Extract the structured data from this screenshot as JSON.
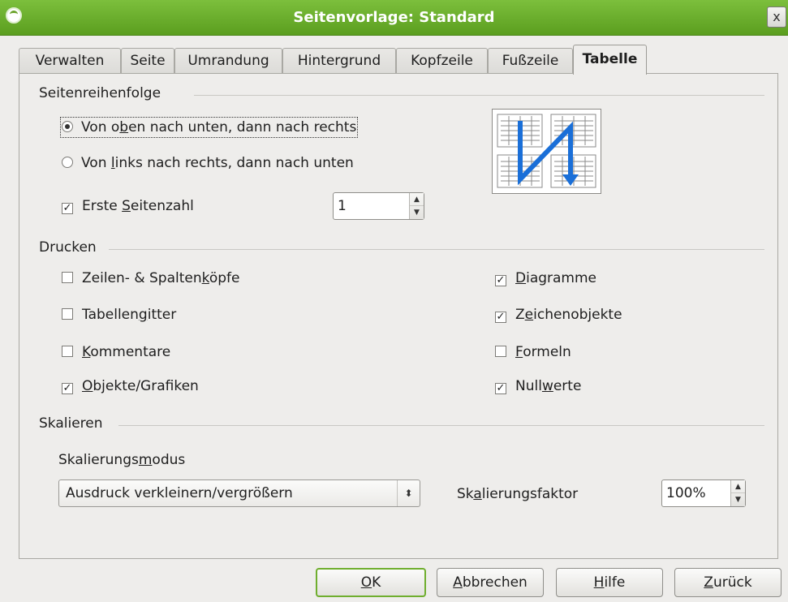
{
  "window": {
    "title": "Seitenvorlage: Standard",
    "close_glyph": "x"
  },
  "tabs": [
    {
      "label": "Verwalten",
      "active": false
    },
    {
      "label": "Seite",
      "active": false
    },
    {
      "label": "Umrandung",
      "active": false
    },
    {
      "label": "Hintergrund",
      "active": false
    },
    {
      "label": "Kopfzeile",
      "active": false
    },
    {
      "label": "Fußzeile",
      "active": false
    },
    {
      "label": "Tabelle",
      "active": true
    }
  ],
  "page_order": {
    "title": "Seitenreihenfolge",
    "options": [
      {
        "pre": "Von o",
        "key": "b",
        "post": "en nach unten, dann nach rechts",
        "selected": true
      },
      {
        "pre": "Von ",
        "key": "l",
        "post": "inks nach rechts, dann nach unten",
        "selected": false
      }
    ],
    "first_page": {
      "pre": "Erste ",
      "key": "S",
      "post": "eitenzahl",
      "checked": true,
      "value": "1"
    }
  },
  "print": {
    "title": "Drucken",
    "left": [
      {
        "pre": "Zeilen- & Spalten",
        "key": "k",
        "post": "öpfe",
        "checked": false
      },
      {
        "pre": "Tabellen",
        "key": "g",
        "post": "itter",
        "checked": false
      },
      {
        "pre": "",
        "key": "K",
        "post": "ommentare",
        "checked": false
      },
      {
        "pre": "",
        "key": "O",
        "post": "bjekte/Grafiken",
        "checked": true
      }
    ],
    "right": [
      {
        "pre": "",
        "key": "D",
        "post": "iagramme",
        "checked": true
      },
      {
        "pre": "Z",
        "key": "e",
        "post": "ichenobjekte",
        "checked": true
      },
      {
        "pre": "",
        "key": "F",
        "post": "ormeln",
        "checked": false
      },
      {
        "pre": "Null",
        "key": "w",
        "post": "erte",
        "checked": true
      }
    ]
  },
  "scale": {
    "title": "Skalieren",
    "mode_label": {
      "pre": "Skalierungs",
      "key": "m",
      "post": "odus"
    },
    "mode_value": "Ausdruck verkleinern/vergrößern",
    "factor_label": {
      "pre": "Sk",
      "key": "a",
      "post": "lierungsfaktor"
    },
    "factor_value": "100%"
  },
  "buttons": [
    {
      "pre": "",
      "key": "O",
      "post": "K"
    },
    {
      "pre": "",
      "key": "A",
      "post": "bbrechen"
    },
    {
      "pre": "",
      "key": "H",
      "post": "ilfe"
    },
    {
      "pre": "",
      "key": "Z",
      "post": "urück"
    }
  ],
  "colors": {
    "titlebar": "#6aaa2b",
    "preview_arrow": "#1a6fd8",
    "default_button_border": "#6fae2e"
  }
}
